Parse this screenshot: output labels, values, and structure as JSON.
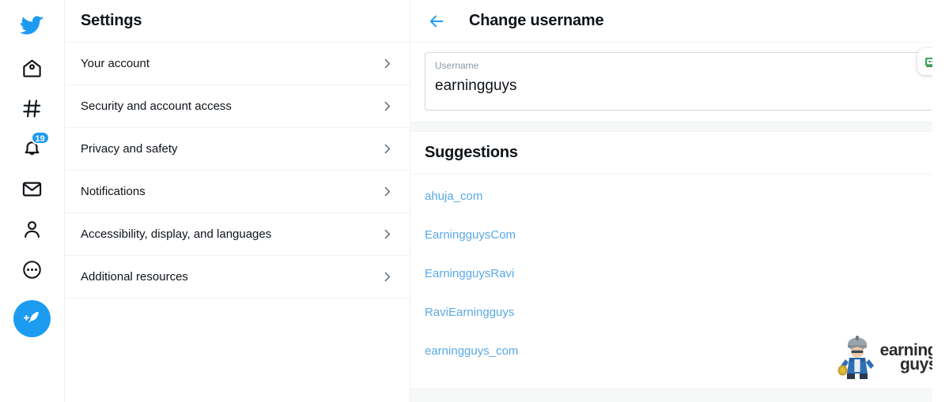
{
  "rail": {
    "items": [
      {
        "name": "twitter-logo",
        "label": "Twitter"
      },
      {
        "name": "home",
        "label": "Home"
      },
      {
        "name": "explore",
        "label": "Explore"
      },
      {
        "name": "notifications",
        "label": "Notifications",
        "badge": "19"
      },
      {
        "name": "messages",
        "label": "Messages"
      },
      {
        "name": "profile",
        "label": "Profile"
      },
      {
        "name": "more",
        "label": "More"
      }
    ],
    "compose_label": "Tweet"
  },
  "settings": {
    "title": "Settings",
    "items": [
      {
        "label": "Your account"
      },
      {
        "label": "Security and account access"
      },
      {
        "label": "Privacy and safety"
      },
      {
        "label": "Notifications"
      },
      {
        "label": "Accessibility, display, and languages"
      },
      {
        "label": "Additional resources"
      }
    ]
  },
  "detail": {
    "back_label": "Back",
    "title": "Change username",
    "username_field": {
      "label": "Username",
      "value": "earningguys",
      "placeholder": "Username"
    },
    "password_manager_icon": "bitwarden-robot-icon",
    "suggestions": {
      "title": "Suggestions",
      "items": [
        "ahuja_com",
        "EarningguysCom",
        "EarningguysRavi",
        "RaviEarningguys",
        "earningguys_com"
      ]
    }
  },
  "watermark": {
    "line1": "earning",
    "line2": "guys"
  },
  "colors": {
    "accent": "#1d9bf0",
    "link": "#5aa9e6",
    "text": "#0f1419",
    "muted": "#536471",
    "border": "#eff3f4",
    "band": "#f7f9f9"
  }
}
